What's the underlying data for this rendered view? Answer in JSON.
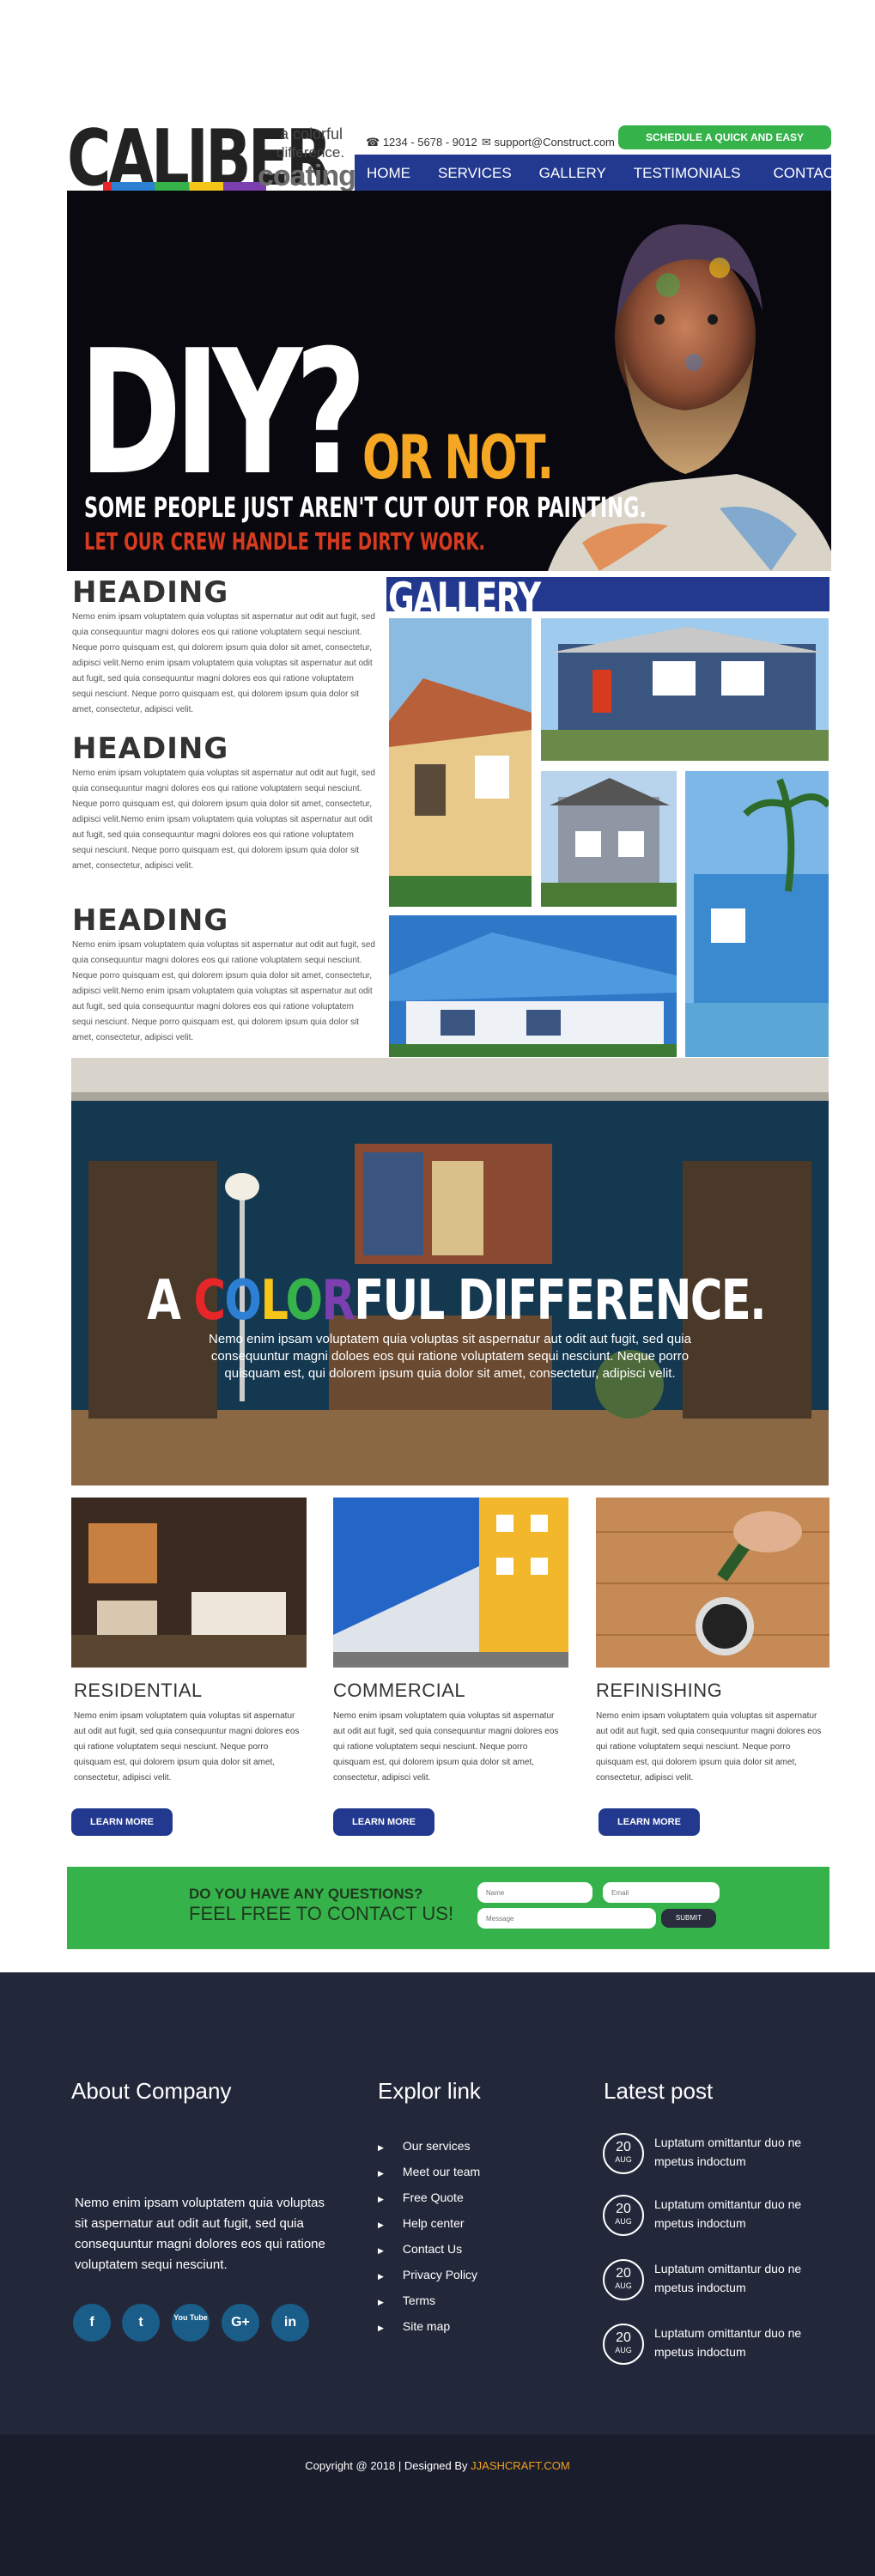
{
  "header": {
    "logo_word": "CALIBER",
    "tagline_1": "a colorful",
    "tagline_2": "difference.",
    "tagline_3": "coatings",
    "phone": "1234 - 5678 - 9012",
    "email": "support@Construct.com",
    "cta": "SCHEDULE A QUICK AND EASY ESTIMATE!",
    "nav": [
      "HOME",
      "SERVICES",
      "GALLERY",
      "TESTIMONIALS",
      "CONTACT"
    ]
  },
  "hero": {
    "title": "DIY?",
    "title_2": "OR NOT.",
    "sub_1": "SOME PEOPLE JUST AREN'T CUT OUT FOR PAINTING.",
    "sub_2": "LET OUR CREW HANDLE THE DIRTY WORK."
  },
  "sections": [
    {
      "heading": "HEADING",
      "text": "Nemo enim ipsam voluptatem quia voluptas sit aspernatur aut odit aut fugit, sed quia consequuntur magni dolores eos qui ratione voluptatem sequi nesciunt. Neque porro quisquam est, qui dolorem ipsum quia dolor sit amet, consectetur, adipisci velit.Nemo enim ipsam voluptatem quia voluptas sit aspernatur aut odit aut fugit, sed quia consequuntur magni dolores eos qui ratione voluptatem sequi nesciunt. Neque porro quisquam est, qui dolorem ipsum quia dolor sit amet, consectetur, adipisci velit."
    },
    {
      "heading": "HEADING",
      "text": "Nemo enim ipsam voluptatem quia voluptas sit aspernatur aut odit aut fugit, sed quia consequuntur magni dolores eos qui ratione voluptatem sequi nesciunt. Neque porro quisquam est, qui dolorem ipsum quia dolor sit amet, consectetur, adipisci velit.Nemo enim ipsam voluptatem quia voluptas sit aspernatur aut odit aut fugit, sed quia consequuntur magni dolores eos qui ratione voluptatem sequi nesciunt. Neque porro quisquam est, qui dolorem ipsum quia dolor sit amet, consectetur, adipisci velit."
    },
    {
      "heading": "HEADING",
      "text": "Nemo enim ipsam voluptatem quia voluptas sit aspernatur aut odit aut fugit, sed quia consequuntur magni dolores eos qui ratione voluptatem sequi nesciunt. Neque porro quisquam est, qui dolorem ipsum quia dolor sit amet, consectetur, adipisci velit.Nemo enim ipsam voluptatem quia voluptas sit aspernatur aut odit aut fugit, sed quia consequuntur magni dolores eos qui ratione voluptatem sequi nesciunt. Neque porro quisquam est, qui dolorem ipsum quia dolor sit amet, consectetur, adipisci velit."
    }
  ],
  "gallery": {
    "title": "GALLERY"
  },
  "banner": {
    "title_letters": [
      "A ",
      "C",
      "O",
      "L",
      "O",
      "R",
      "FUL DIFFERENCE."
    ],
    "text": "Nemo enim ipsam voluptatem quia voluptas sit aspernatur aut odit aut fugit, sed quia consequuntur magni doloes eos qui ratione voluptatem sequi nesciunt. Neque porro quisquam est, qui dolorem ipsum quia dolor sit amet, consectetur, adipisci velit."
  },
  "services": [
    {
      "title": "RESIDENTIAL",
      "text": "Nemo enim ipsam voluptatem quia voluptas sit aspernatur aut odit aut fugit, sed quia consequuntur magni dolores eos qui ratione voluptatem sequi nesciunt. Neque porro quisquam est, qui dolorem ipsum quia dolor sit amet, consectetur, adipisci velit.",
      "button": "LEARN MORE"
    },
    {
      "title": "COMMERCIAL",
      "text": "Nemo enim ipsam voluptatem quia voluptas sit aspernatur aut odit aut fugit, sed quia consequuntur magni dolores eos qui ratione voluptatem sequi nesciunt. Neque porro quisquam est, qui dolorem ipsum quia dolor sit amet, consectetur, adipisci velit.",
      "button": "LEARN MORE"
    },
    {
      "title": "REFINISHING",
      "text": "Nemo enim ipsam voluptatem quia voluptas sit aspernatur aut odit aut fugit, sed quia consequuntur magni dolores eos qui ratione voluptatem sequi nesciunt. Neque porro quisquam est, qui dolorem ipsum quia dolor sit amet, consectetur, adipisci velit.",
      "button": "LEARN MORE"
    }
  ],
  "contact": {
    "question": "DO YOU HAVE ANY QUESTIONS?",
    "invite": "FEEL FREE TO CONTACT US!",
    "name_placeholder": "Name",
    "email_placeholder": "Email",
    "message_placeholder": "Message",
    "submit": "SUBMIT"
  },
  "footer": {
    "about_title": "About Company",
    "about_text": "Nemo enim ipsam voluptatem quia voluptas sit aspernatur aut odit aut fugit, sed quia consequuntur magni dolores eos qui ratione voluptatem sequi nesciunt.",
    "social": [
      "f",
      "t",
      "You Tube",
      "G+",
      "in"
    ],
    "links_title": "Explor link",
    "links": [
      "Our services",
      "Meet our team",
      "Free Quote",
      "Help center",
      "Contact Us",
      "Privacy Policy",
      "Terms",
      "Site map"
    ],
    "posts_title": "Latest post",
    "posts": [
      {
        "day": "20",
        "month": "AUG",
        "text": "Luptatum omittantur duo ne mpetus indoctum"
      },
      {
        "day": "20",
        "month": "AUG",
        "text": "Luptatum omittantur duo ne mpetus indoctum"
      },
      {
        "day": "20",
        "month": "AUG",
        "text": "Luptatum omittantur duo ne mpetus indoctum"
      },
      {
        "day": "20",
        "month": "AUG",
        "text": "Luptatum omittantur duo ne mpetus indoctum"
      }
    ],
    "copyright": "Copyright @ 2018 | Designed By ",
    "designer": "JJASHCRAFT.COM"
  },
  "colors": {
    "brand_blue": "#22398f",
    "brand_green": "#36b24a",
    "footer_bg": "#23273a",
    "accent_orange": "#f5a623",
    "accent_red": "#d63a1f"
  },
  "icons": [
    "phone-icon",
    "envelope-icon",
    "arrow-right-icon",
    "facebook-icon",
    "twitter-icon",
    "youtube-icon",
    "google-plus-icon",
    "linkedin-icon"
  ]
}
